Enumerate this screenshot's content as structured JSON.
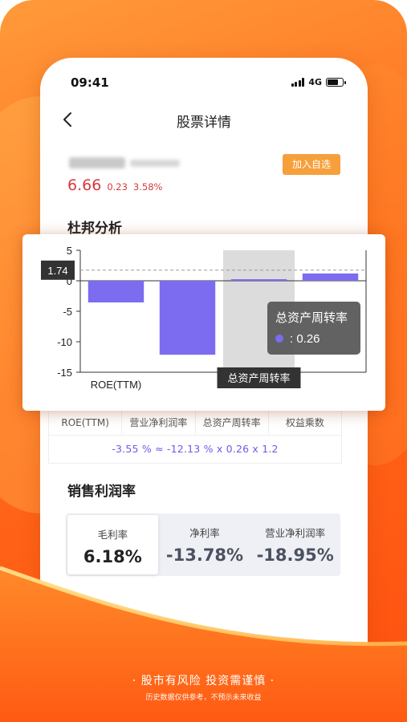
{
  "status": {
    "time": "09:41",
    "network": "4G"
  },
  "nav": {
    "title": "股票详情"
  },
  "stock": {
    "price": "6.66",
    "change": "0.23",
    "change_pct": "3.58%",
    "add_label": "加入自选"
  },
  "sections": {
    "dupont": "杜邦分析",
    "margin": "销售利润率"
  },
  "chart_data": {
    "type": "bar",
    "categories": [
      "ROE(TTM)",
      "营业净利润率",
      "总资产周转率",
      "权益乘数"
    ],
    "values": [
      -3.55,
      -12.13,
      0.26,
      1.2
    ],
    "ylim": [
      -15,
      5
    ],
    "yticks": [
      5,
      0,
      -5,
      -10,
      -15
    ],
    "reference_line": 1.74,
    "reference_label": "1.74",
    "bar_color": "#7b6cf0",
    "highlighted_category": "总资产周转率",
    "tooltip": {
      "title": "总资产周转率",
      "value": ": 0.26"
    },
    "visible_x_label": "ROE(TTM)",
    "grid": false
  },
  "formula": {
    "headers": [
      "ROE(TTM)",
      "营业净利润率",
      "总资产周转率",
      "权益乘数"
    ],
    "expression": "-3.55 %  ≈  -12.13 %  x  0.26  x  1.2"
  },
  "margins": [
    {
      "label": "毛利率",
      "value": "6.18%",
      "active": true
    },
    {
      "label": "净利率",
      "value": "-13.78%",
      "active": false
    },
    {
      "label": "营业净利润率",
      "value": "-18.95%",
      "active": false
    }
  ],
  "slogan": {
    "main": "· 股市有风险 投资需谨慎 ·",
    "sub": "历史数据仅供参考，不预示未来收益"
  },
  "colors": {
    "accent_orange": "#ff6a1a",
    "price_red": "#d83a3a",
    "bar_purple": "#7b6cf0",
    "add_button": "#f6a03c"
  }
}
